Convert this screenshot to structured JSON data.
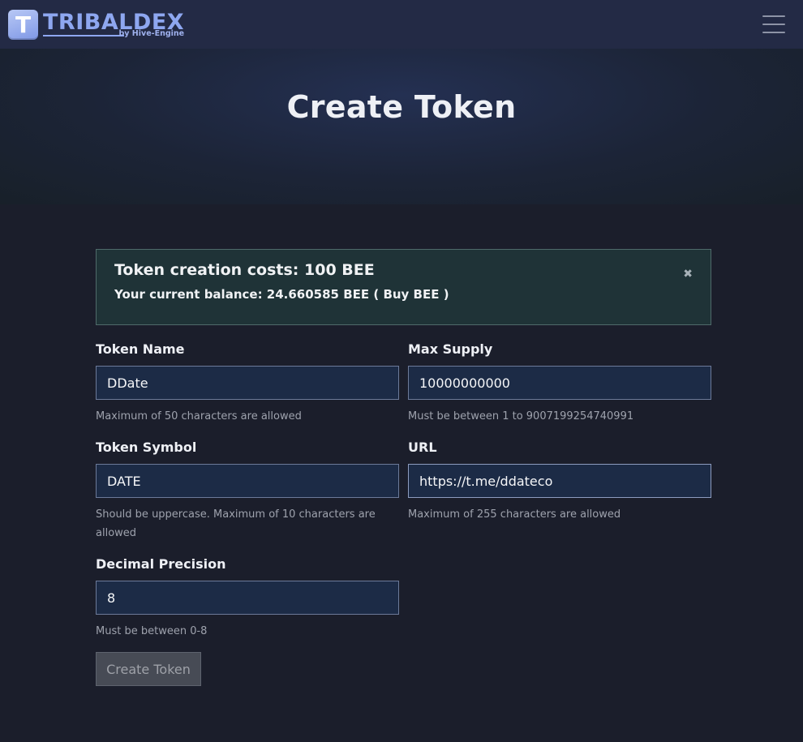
{
  "navbar": {
    "logo_letter": "T",
    "brand_name": "TRIBALDEX",
    "brand_sub": "by Hive-Engine"
  },
  "page": {
    "title": "Create Token"
  },
  "alert": {
    "title": "Token creation costs: 100 BEE",
    "balance_prefix": "Your current balance: 24.660585 BEE (",
    "buy_link": " Buy BEE ",
    "balance_suffix": ")",
    "close_glyph": "✖"
  },
  "form": {
    "token_name": {
      "label": "Token Name",
      "value": "DDate",
      "help": "Maximum of 50 characters are allowed"
    },
    "max_supply": {
      "label": "Max Supply",
      "value": "10000000000",
      "help": "Must be between 1 to 9007199254740991"
    },
    "token_symbol": {
      "label": "Token Symbol",
      "value": "DATE",
      "help": "Should be uppercase. Maximum of 10 characters are allowed"
    },
    "url": {
      "label": "URL",
      "value": "https://t.me/ddateco",
      "help": "Maximum of 255 characters are allowed"
    },
    "decimal_precision": {
      "label": "Decimal Precision",
      "value": "8",
      "help": "Must be between 0-8"
    },
    "submit_label": "Create Token"
  }
}
